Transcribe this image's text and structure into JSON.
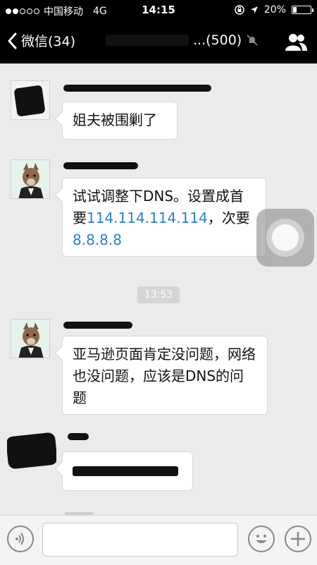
{
  "status_bar": {
    "carrier": "中国移动",
    "network": "4G",
    "time": "14:15",
    "battery_percent": "20%",
    "battery_level": 0.2,
    "signal_bars": 2
  },
  "nav": {
    "back_label": "微信(34)",
    "title_suffix": "...(500)"
  },
  "messages": [
    {
      "text": "姐夫被围剿了"
    },
    {
      "segments": [
        "试试调整下DNS。设置成首要",
        "114.114.114.114",
        "，次要",
        "8.8.8.8"
      ]
    },
    {
      "text": "亚马逊页面肯定没问题，网络也没问题，应该是DNS的问题"
    }
  ],
  "timestamp": "13:53",
  "colors": {
    "link": "#2a7fd6",
    "background": "#ebebeb",
    "topbar": "#000000"
  }
}
